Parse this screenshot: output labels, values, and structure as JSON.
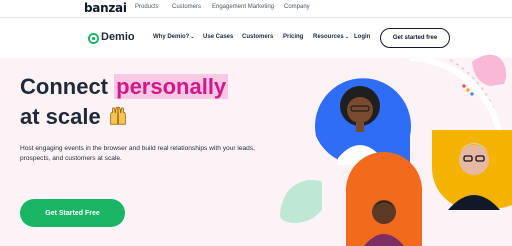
{
  "topbar": {
    "logo": "banzai",
    "items": [
      "Products",
      "Customers",
      "Engagement Marketing",
      "Company"
    ]
  },
  "nav": {
    "logo_text": "Demio",
    "items": [
      {
        "label": "Why Demio?",
        "dropdown": true
      },
      {
        "label": "Use Cases",
        "dropdown": false
      },
      {
        "label": "Customers",
        "dropdown": false
      },
      {
        "label": "Pricing",
        "dropdown": false
      },
      {
        "label": "Resources",
        "dropdown": true
      },
      {
        "label": "Login",
        "dropdown": false
      }
    ],
    "cta": "Get started free"
  },
  "hero": {
    "title_part1": "Connect ",
    "title_highlight": "personally",
    "title_part2": "at scale",
    "subtitle": "Host engaging events in the browser and build real relationships with your leads, prospects, and customers at scale.",
    "button": "Get Started Free"
  },
  "colors": {
    "brand_green": "#19b464",
    "highlight_pink": "#d3178a",
    "blue": "#2f6df6",
    "yellow": "#f5b301",
    "orange": "#f26b1d",
    "mint": "#bfe8d4"
  },
  "icons": [
    "demio-logo-icon",
    "raised-hands-icon",
    "chevron-down-icon"
  ]
}
